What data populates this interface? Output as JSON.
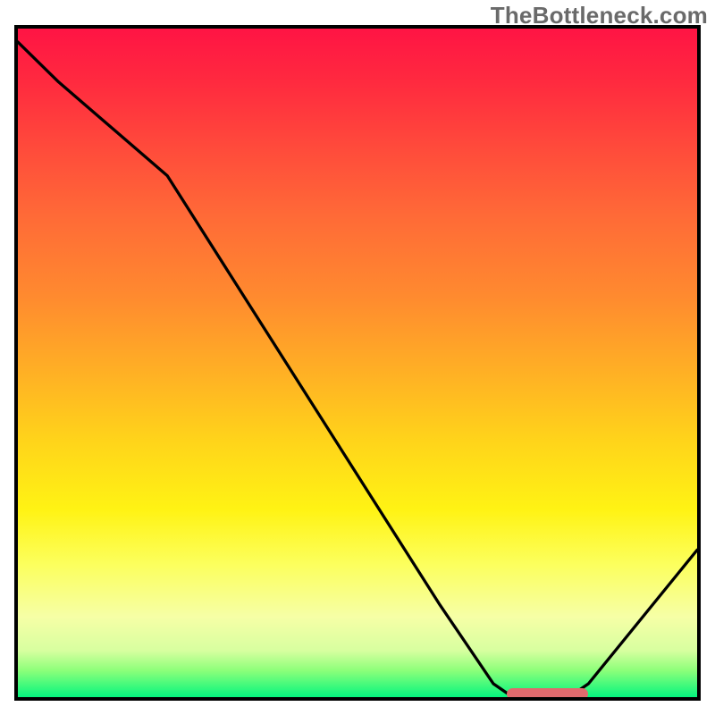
{
  "watermark": "TheBottleneck.com",
  "chart_data": {
    "type": "line",
    "title": "",
    "xlabel": "",
    "ylabel": "",
    "xlim": [
      0,
      100
    ],
    "ylim": [
      0,
      100
    ],
    "grid": false,
    "legend": false,
    "series": [
      {
        "name": "bottleneck-curve",
        "x": [
          0,
          6,
          22,
          62,
          70,
          72,
          82,
          84,
          100
        ],
        "y": [
          98,
          92,
          78,
          14,
          2,
          0.6,
          0.6,
          2,
          22
        ]
      }
    ],
    "marker": {
      "name": "optimal-range",
      "x_start": 72,
      "x_end": 84,
      "y": 0.6,
      "color": "#e06a6d"
    },
    "gradient_colors": {
      "top": "#ff1444",
      "mid_upper": "#ff8a2f",
      "mid": "#fff314",
      "mid_lower": "#d8ffa0",
      "bottom": "#05f57e"
    }
  }
}
